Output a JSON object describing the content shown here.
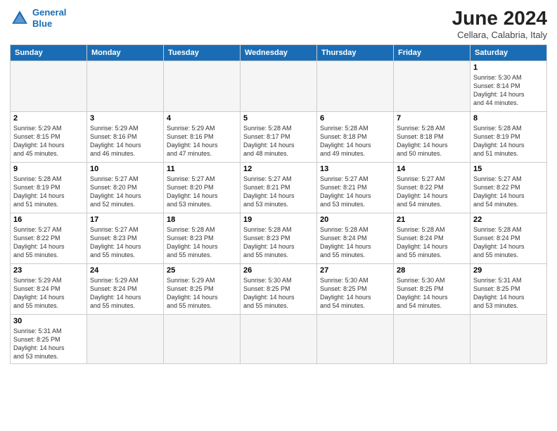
{
  "header": {
    "logo_general": "General",
    "logo_blue": "Blue",
    "month": "June 2024",
    "location": "Cellara, Calabria, Italy"
  },
  "weekdays": [
    "Sunday",
    "Monday",
    "Tuesday",
    "Wednesday",
    "Thursday",
    "Friday",
    "Saturday"
  ],
  "weeks": [
    [
      {
        "day": "",
        "info": ""
      },
      {
        "day": "",
        "info": ""
      },
      {
        "day": "",
        "info": ""
      },
      {
        "day": "",
        "info": ""
      },
      {
        "day": "",
        "info": ""
      },
      {
        "day": "",
        "info": ""
      },
      {
        "day": "1",
        "info": "Sunrise: 5:30 AM\nSunset: 8:14 PM\nDaylight: 14 hours\nand 44 minutes."
      }
    ],
    [
      {
        "day": "2",
        "info": "Sunrise: 5:29 AM\nSunset: 8:15 PM\nDaylight: 14 hours\nand 45 minutes."
      },
      {
        "day": "3",
        "info": "Sunrise: 5:29 AM\nSunset: 8:16 PM\nDaylight: 14 hours\nand 46 minutes."
      },
      {
        "day": "4",
        "info": "Sunrise: 5:29 AM\nSunset: 8:16 PM\nDaylight: 14 hours\nand 47 minutes."
      },
      {
        "day": "5",
        "info": "Sunrise: 5:28 AM\nSunset: 8:17 PM\nDaylight: 14 hours\nand 48 minutes."
      },
      {
        "day": "6",
        "info": "Sunrise: 5:28 AM\nSunset: 8:18 PM\nDaylight: 14 hours\nand 49 minutes."
      },
      {
        "day": "7",
        "info": "Sunrise: 5:28 AM\nSunset: 8:18 PM\nDaylight: 14 hours\nand 50 minutes."
      },
      {
        "day": "8",
        "info": "Sunrise: 5:28 AM\nSunset: 8:19 PM\nDaylight: 14 hours\nand 51 minutes."
      }
    ],
    [
      {
        "day": "9",
        "info": "Sunrise: 5:28 AM\nSunset: 8:19 PM\nDaylight: 14 hours\nand 51 minutes."
      },
      {
        "day": "10",
        "info": "Sunrise: 5:27 AM\nSunset: 8:20 PM\nDaylight: 14 hours\nand 52 minutes."
      },
      {
        "day": "11",
        "info": "Sunrise: 5:27 AM\nSunset: 8:20 PM\nDaylight: 14 hours\nand 53 minutes."
      },
      {
        "day": "12",
        "info": "Sunrise: 5:27 AM\nSunset: 8:21 PM\nDaylight: 14 hours\nand 53 minutes."
      },
      {
        "day": "13",
        "info": "Sunrise: 5:27 AM\nSunset: 8:21 PM\nDaylight: 14 hours\nand 53 minutes."
      },
      {
        "day": "14",
        "info": "Sunrise: 5:27 AM\nSunset: 8:22 PM\nDaylight: 14 hours\nand 54 minutes."
      },
      {
        "day": "15",
        "info": "Sunrise: 5:27 AM\nSunset: 8:22 PM\nDaylight: 14 hours\nand 54 minutes."
      }
    ],
    [
      {
        "day": "16",
        "info": "Sunrise: 5:27 AM\nSunset: 8:22 PM\nDaylight: 14 hours\nand 55 minutes."
      },
      {
        "day": "17",
        "info": "Sunrise: 5:27 AM\nSunset: 8:23 PM\nDaylight: 14 hours\nand 55 minutes."
      },
      {
        "day": "18",
        "info": "Sunrise: 5:28 AM\nSunset: 8:23 PM\nDaylight: 14 hours\nand 55 minutes."
      },
      {
        "day": "19",
        "info": "Sunrise: 5:28 AM\nSunset: 8:23 PM\nDaylight: 14 hours\nand 55 minutes."
      },
      {
        "day": "20",
        "info": "Sunrise: 5:28 AM\nSunset: 8:24 PM\nDaylight: 14 hours\nand 55 minutes."
      },
      {
        "day": "21",
        "info": "Sunrise: 5:28 AM\nSunset: 8:24 PM\nDaylight: 14 hours\nand 55 minutes."
      },
      {
        "day": "22",
        "info": "Sunrise: 5:28 AM\nSunset: 8:24 PM\nDaylight: 14 hours\nand 55 minutes."
      }
    ],
    [
      {
        "day": "23",
        "info": "Sunrise: 5:29 AM\nSunset: 8:24 PM\nDaylight: 14 hours\nand 55 minutes."
      },
      {
        "day": "24",
        "info": "Sunrise: 5:29 AM\nSunset: 8:24 PM\nDaylight: 14 hours\nand 55 minutes."
      },
      {
        "day": "25",
        "info": "Sunrise: 5:29 AM\nSunset: 8:25 PM\nDaylight: 14 hours\nand 55 minutes."
      },
      {
        "day": "26",
        "info": "Sunrise: 5:30 AM\nSunset: 8:25 PM\nDaylight: 14 hours\nand 55 minutes."
      },
      {
        "day": "27",
        "info": "Sunrise: 5:30 AM\nSunset: 8:25 PM\nDaylight: 14 hours\nand 54 minutes."
      },
      {
        "day": "28",
        "info": "Sunrise: 5:30 AM\nSunset: 8:25 PM\nDaylight: 14 hours\nand 54 minutes."
      },
      {
        "day": "29",
        "info": "Sunrise: 5:31 AM\nSunset: 8:25 PM\nDaylight: 14 hours\nand 53 minutes."
      }
    ],
    [
      {
        "day": "30",
        "info": "Sunrise: 5:31 AM\nSunset: 8:25 PM\nDaylight: 14 hours\nand 53 minutes."
      },
      {
        "day": "",
        "info": ""
      },
      {
        "day": "",
        "info": ""
      },
      {
        "day": "",
        "info": ""
      },
      {
        "day": "",
        "info": ""
      },
      {
        "day": "",
        "info": ""
      },
      {
        "day": "",
        "info": ""
      }
    ]
  ]
}
